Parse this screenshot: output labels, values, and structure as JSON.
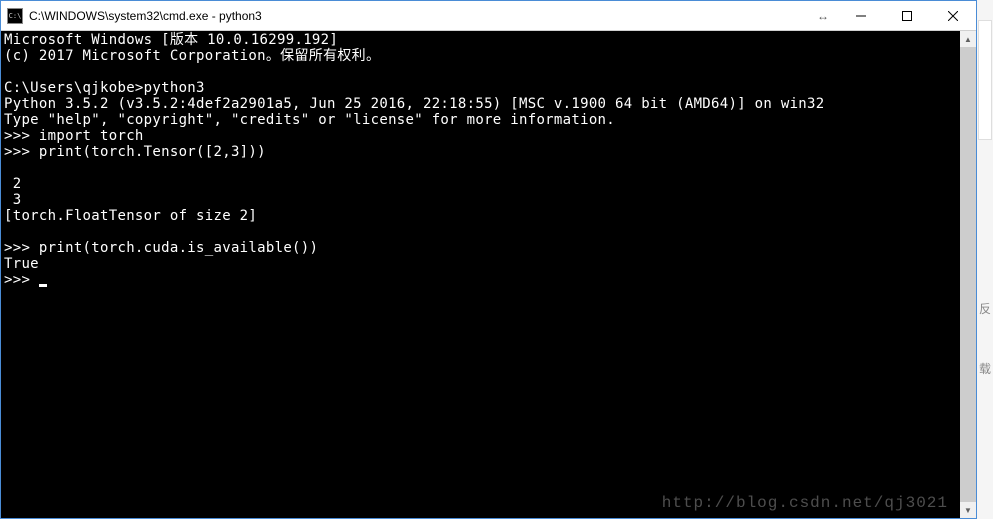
{
  "window": {
    "title": "C:\\WINDOWS\\system32\\cmd.exe - python3",
    "icon_label": "C:\\"
  },
  "terminal": {
    "lines": [
      "Microsoft Windows [版本 10.0.16299.192]",
      "(c) 2017 Microsoft Corporation。保留所有权利。",
      "",
      "C:\\Users\\qjkobe>python3",
      "Python 3.5.2 (v3.5.2:4def2a2901a5, Jun 25 2016, 22:18:55) [MSC v.1900 64 bit (AMD64)] on win32",
      "Type \"help\", \"copyright\", \"credits\" or \"license\" for more information.",
      ">>> import torch",
      ">>> print(torch.Tensor([2,3]))",
      "",
      " 2",
      " 3",
      "[torch.FloatTensor of size 2]",
      "",
      ">>> print(torch.cuda.is_available())",
      "True",
      ">>> "
    ]
  },
  "watermark": "http://blog.csdn.net/qj3021",
  "side_hints": {
    "a": "反",
    "b": "载"
  }
}
